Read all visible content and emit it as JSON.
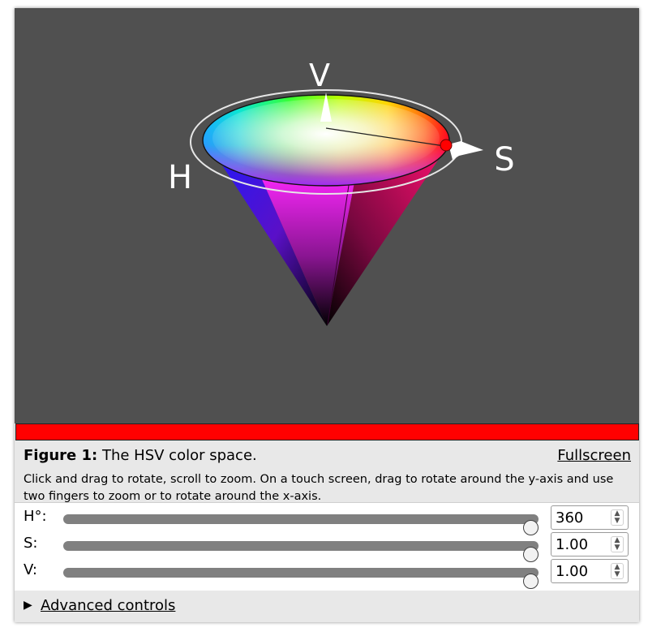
{
  "viewport": {
    "axis_labels": {
      "v": "V",
      "s": "S",
      "h": "H"
    },
    "background": "#505050"
  },
  "current_color": {
    "hex": "#ff0000"
  },
  "caption": {
    "figure_label": "Figure 1:",
    "figure_title": "The HSV color space.",
    "fullscreen_link": "Fullscreen",
    "description": "Click and drag to rotate, scroll to zoom. On a touch screen, drag to rotate around the y-axis and use two fingers to zoom or to rotate around the x-axis."
  },
  "controls": {
    "h": {
      "label": "H°:",
      "value": "360",
      "fraction": 1.0
    },
    "s": {
      "label": "S:",
      "value": "1.00",
      "fraction": 1.0
    },
    "v": {
      "label": "V:",
      "value": "1.00",
      "fraction": 1.0
    }
  },
  "advanced": {
    "label": "Advanced controls",
    "icon": "triangle-right-icon"
  }
}
